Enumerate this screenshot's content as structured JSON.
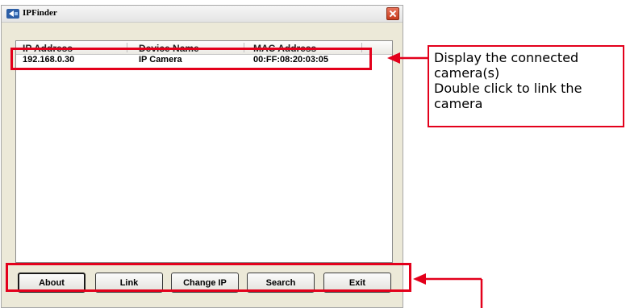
{
  "window": {
    "title": "IPFinder"
  },
  "columns": [
    "IP Address",
    "Device Name",
    "MAC Address"
  ],
  "devices": [
    {
      "ip": "192.168.0.30",
      "name": "IP Camera",
      "mac": "00:FF:08:20:03:05"
    }
  ],
  "buttons": {
    "about": "About",
    "link": "Link",
    "change_ip": "Change IP",
    "search": "Search",
    "exit": "Exit"
  },
  "callout": {
    "lines": [
      "Display the connected",
      "camera(s)",
      "Double click to link the",
      "camera"
    ]
  },
  "colors": {
    "annotation": "#e3001b",
    "window_bg": "#ece9d8"
  }
}
